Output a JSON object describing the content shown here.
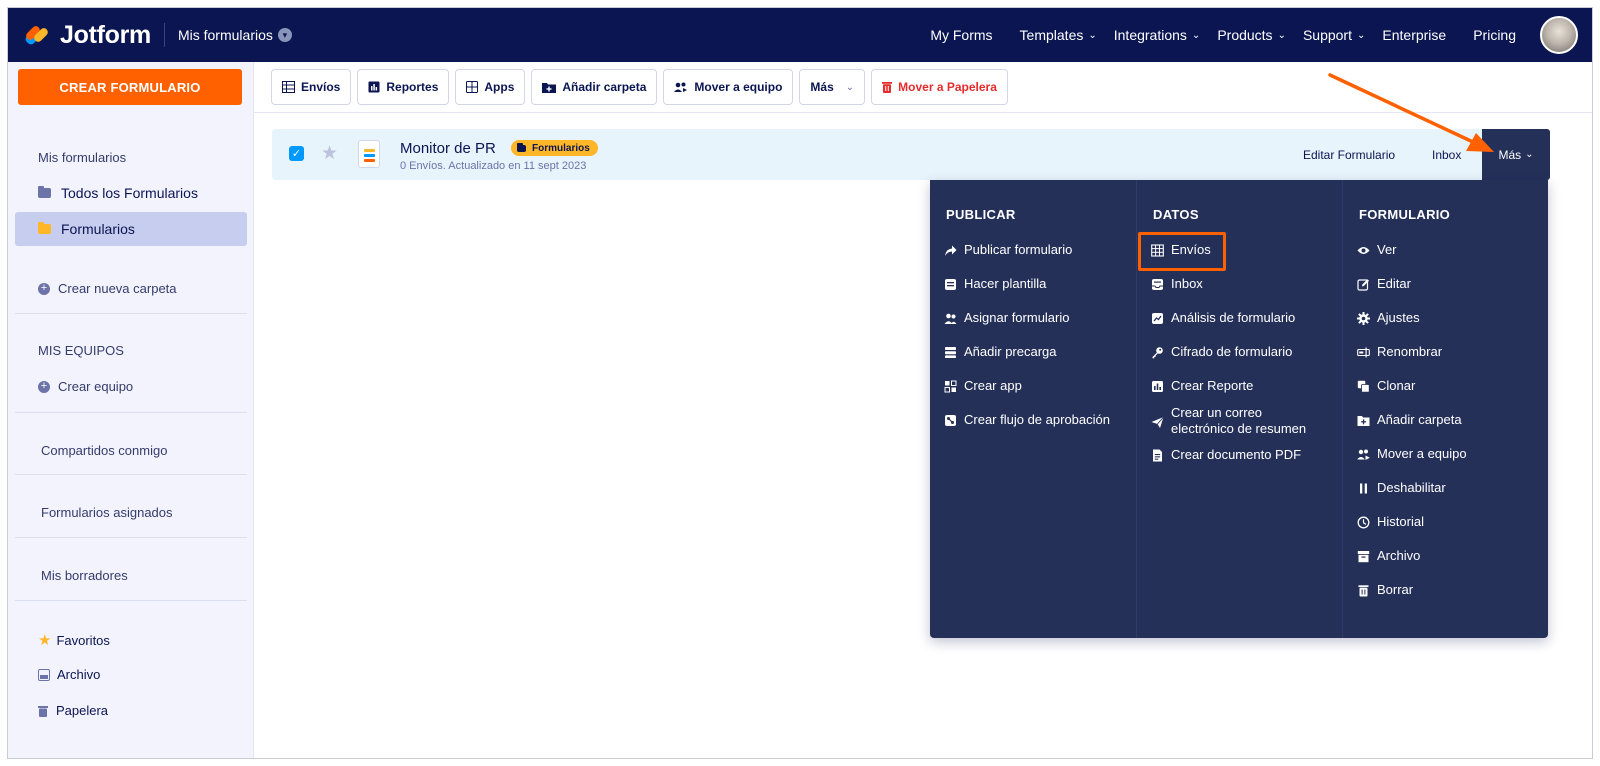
{
  "header": {
    "brand": "Jotform",
    "team_switch": "Mis formularios",
    "nav": [
      {
        "label": "My Forms",
        "dropdown": false
      },
      {
        "label": "Templates",
        "dropdown": true
      },
      {
        "label": "Integrations",
        "dropdown": true
      },
      {
        "label": "Products",
        "dropdown": true
      },
      {
        "label": "Support",
        "dropdown": true
      },
      {
        "label": "Enterprise",
        "dropdown": false
      },
      {
        "label": "Pricing",
        "dropdown": false
      }
    ]
  },
  "sidebar": {
    "create_button": "CREAR FORMULARIO",
    "my_forms_heading": "Mis formularios",
    "all_forms": "Todos los Formularios",
    "forms_folder": "Formularios",
    "new_folder": "Crear nueva carpeta",
    "teams_heading": "MIS EQUIPOS",
    "create_team": "Crear equipo",
    "shared": "Compartidos conmigo",
    "assigned": "Formularios asignados",
    "drafts": "Mis borradores",
    "favorites": "Favoritos",
    "archive": "Archivo",
    "trash": "Papelera"
  },
  "toolbar": {
    "submissions": "Envíos",
    "reports": "Reportes",
    "apps": "Apps",
    "add_folder": "Añadir carpeta",
    "move_team": "Mover a equipo",
    "more": "Más",
    "trash": "Mover a Papelera"
  },
  "form_row": {
    "title": "Monitor de PR",
    "tag": "Formularios",
    "subtitle": "0 Envíos. Actualizado en 11 sept 2023",
    "edit": "Editar Formulario",
    "inbox": "Inbox",
    "more": "Más"
  },
  "dropdown": {
    "publish": {
      "heading": "PUBLICAR",
      "items": [
        "Publicar formulario",
        "Hacer plantilla",
        "Asignar formulario",
        "Añadir precarga",
        "Crear app",
        "Crear flujo de aprobación"
      ]
    },
    "data": {
      "heading": "DATOS",
      "items": [
        "Envíos",
        "Inbox",
        "Análisis de formulario",
        "Cifrado de formulario",
        "Crear Reporte",
        "Crear un correo",
        "electrónico de resumen",
        "Crear documento PDF"
      ]
    },
    "form": {
      "heading": "FORMULARIO",
      "items": [
        "Ver",
        "Editar",
        "Ajustes",
        "Renombrar",
        "Clonar",
        "Añadir carpeta",
        "Mover a equipo",
        "Deshabilitar",
        "Historial",
        "Archivo",
        "Borrar"
      ]
    }
  },
  "colors": {
    "navy": "#0a1551",
    "menu_bg": "#253059",
    "accent_orange": "#ff6100",
    "tag_yellow": "#ffb629",
    "checkbox_blue": "#0099ff",
    "trash_red": "#e62c2c"
  }
}
